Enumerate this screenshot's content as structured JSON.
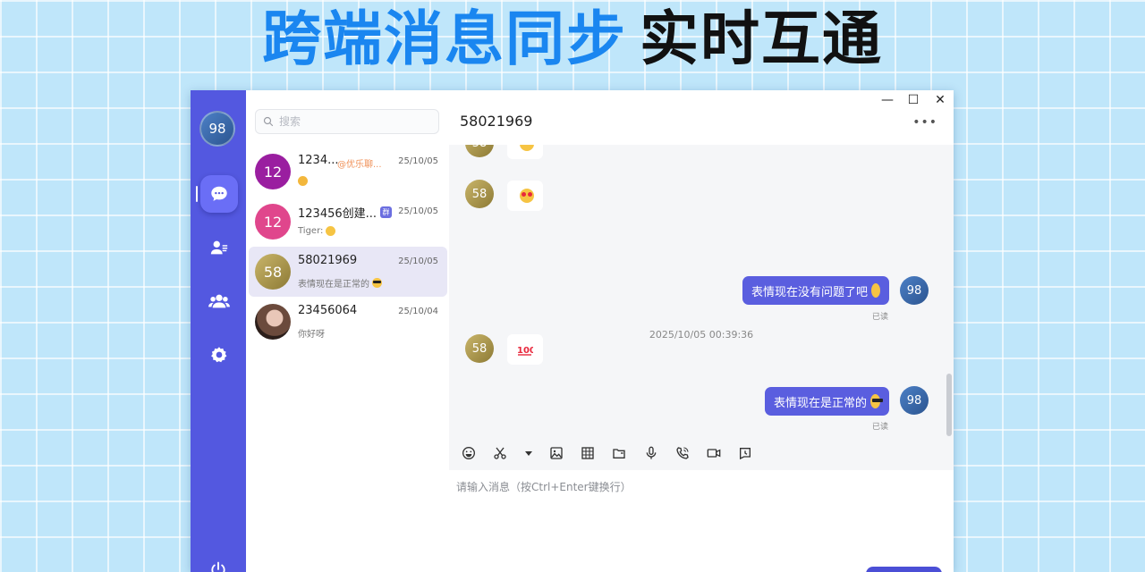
{
  "headline": {
    "blue_part": "跨端消息同步",
    "black_part": "实时互通"
  },
  "me": {
    "avatar_text": "98"
  },
  "search": {
    "placeholder": "搜索"
  },
  "conversations": [
    {
      "name": "1234...",
      "tag": "@优乐聊...",
      "time": "25/10/05",
      "preview": "",
      "avatar_text": "12",
      "avatar_color": "#9a1ea0"
    },
    {
      "name": "123456创建...",
      "badge": "群",
      "time": "25/10/05",
      "preview": "Tiger:",
      "avatar_text": "12",
      "avatar_color": "#e0468c"
    },
    {
      "name": "58021969",
      "time": "25/10/05",
      "preview": "表情现在是正常的",
      "avatar_text": "58",
      "avatar_color": "#b7a251"
    },
    {
      "name": "23456064",
      "time": "25/10/04",
      "preview": "你好呀",
      "avatar_text": "",
      "avatar_color": "#6b4a3c"
    }
  ],
  "chat": {
    "title": "58021969",
    "window_controls": {
      "minimize": "—",
      "maximize": "☐",
      "close": "✕"
    },
    "more": "•••",
    "messages": {
      "peer_avatar": "58",
      "my_avatar": "98",
      "timestamp": "2025/10/05 00:39:36",
      "sent_1": "表情现在没有问题了吧",
      "sent_2": "表情现在是正常的",
      "read_label": "已读"
    },
    "input_placeholder": "请输入消息（按Ctrl+Enter键换行）"
  },
  "colors": {
    "rail": "#5358e0",
    "bubble": "#5a5edf",
    "selected": "#e8e7f6"
  }
}
